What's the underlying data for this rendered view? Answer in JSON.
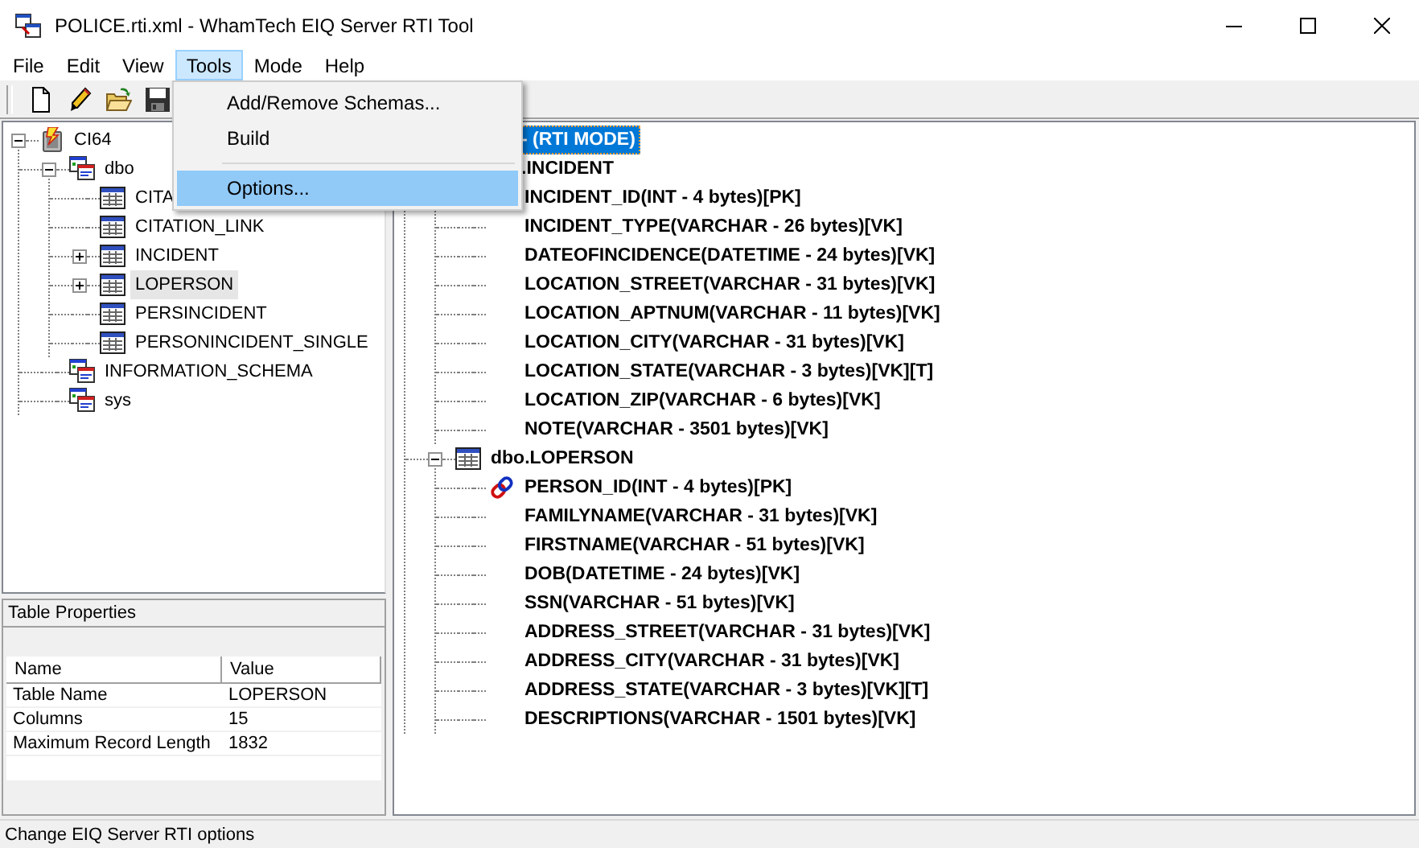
{
  "window": {
    "title": "POLICE.rti.xml - WhamTech EIQ Server RTI Tool"
  },
  "menu": [
    {
      "label": "File",
      "selected": false
    },
    {
      "label": "Edit",
      "selected": false
    },
    {
      "label": "View",
      "selected": false
    },
    {
      "label": "Tools",
      "selected": true
    },
    {
      "label": "Mode",
      "selected": false
    },
    {
      "label": "Help",
      "selected": false
    }
  ],
  "tools_menu": [
    {
      "kind": "item",
      "label": "Add/Remove Schemas...",
      "selected": false
    },
    {
      "kind": "item",
      "label": "Build",
      "selected": false
    },
    {
      "kind": "separator"
    },
    {
      "kind": "item",
      "label": "Options...",
      "selected": true
    }
  ],
  "schema_tree": [
    {
      "label": "CI64",
      "kind": "database",
      "expanded": true,
      "selected": false,
      "children": [
        {
          "label": "dbo",
          "kind": "schema",
          "expanded": true,
          "selected": false,
          "children": [
            {
              "label": "CITA",
              "kind": "table",
              "selected": false
            },
            {
              "label": "CITATION_LINK",
              "kind": "table",
              "selected": false
            },
            {
              "label": "INCIDENT",
              "kind": "table",
              "expanded": false,
              "selected": false
            },
            {
              "label": "LOPERSON",
              "kind": "table",
              "expanded": false,
              "selected": true
            },
            {
              "label": "PERSINCIDENT",
              "kind": "table",
              "selected": false
            },
            {
              "label": "PERSONINCIDENT_SINGLE",
              "kind": "table",
              "selected": false
            }
          ]
        },
        {
          "label": "INFORMATION_SCHEMA",
          "kind": "schema",
          "selected": false
        },
        {
          "label": "sys",
          "kind": "schema",
          "selected": false
        }
      ]
    }
  ],
  "table_properties": {
    "title": "Table Properties",
    "columns": [
      "Name",
      "Value"
    ],
    "rows": [
      [
        "Table Name",
        "LOPERSON"
      ],
      [
        "Columns",
        "15"
      ],
      [
        "Maximum Record Length",
        "1832"
      ]
    ]
  },
  "rti_tree": [
    {
      "label": "- (RTI MODE)",
      "kind": "covered",
      "selected": true,
      "children": [
        {
          "label": ".INCIDENT",
          "kind": "covered",
          "selected": false,
          "children": [
            {
              "label": "INCIDENT_ID(INT - 4 bytes)[PK]",
              "kind": "field",
              "selected": false
            },
            {
              "label": "INCIDENT_TYPE(VARCHAR - 26 bytes)[VK]",
              "kind": "field",
              "selected": false
            },
            {
              "label": "DATEOFINCIDENCE(DATETIME - 24 bytes)[VK]",
              "kind": "field",
              "selected": false
            },
            {
              "label": "LOCATION_STREET(VARCHAR - 31 bytes)[VK]",
              "kind": "field",
              "selected": false
            },
            {
              "label": "LOCATION_APTNUM(VARCHAR - 11 bytes)[VK]",
              "kind": "field",
              "selected": false
            },
            {
              "label": "LOCATION_CITY(VARCHAR - 31 bytes)[VK]",
              "kind": "field",
              "selected": false
            },
            {
              "label": "LOCATION_STATE(VARCHAR - 3 bytes)[VK][T]",
              "kind": "field",
              "selected": false
            },
            {
              "label": "LOCATION_ZIP(VARCHAR - 6 bytes)[VK]",
              "kind": "field",
              "selected": false
            },
            {
              "label": "NOTE(VARCHAR - 3501 bytes)[VK]",
              "kind": "field",
              "selected": false
            }
          ]
        },
        {
          "label": "dbo.LOPERSON",
          "kind": "table",
          "expanded": true,
          "selected": false,
          "children": [
            {
              "label": "PERSON_ID(INT - 4 bytes)[PK]",
              "kind": "pk",
              "selected": false
            },
            {
              "label": "FAMILYNAME(VARCHAR - 31 bytes)[VK]",
              "kind": "field",
              "selected": false
            },
            {
              "label": "FIRSTNAME(VARCHAR - 51 bytes)[VK]",
              "kind": "field",
              "selected": false
            },
            {
              "label": "DOB(DATETIME - 24 bytes)[VK]",
              "kind": "field",
              "selected": false
            },
            {
              "label": "SSN(VARCHAR - 51 bytes)[VK]",
              "kind": "field",
              "selected": false
            },
            {
              "label": "ADDRESS_STREET(VARCHAR - 31 bytes)[VK]",
              "kind": "field",
              "selected": false
            },
            {
              "label": "ADDRESS_CITY(VARCHAR - 31 bytes)[VK]",
              "kind": "field",
              "selected": false
            },
            {
              "label": "ADDRESS_STATE(VARCHAR - 3 bytes)[VK][T]",
              "kind": "field",
              "selected": false
            },
            {
              "label": "DESCRIPTIONS(VARCHAR - 1501 bytes)[VK]",
              "kind": "field",
              "selected": false
            }
          ]
        }
      ]
    }
  ],
  "status_bar": {
    "text": "Change EIQ Server RTI options"
  }
}
